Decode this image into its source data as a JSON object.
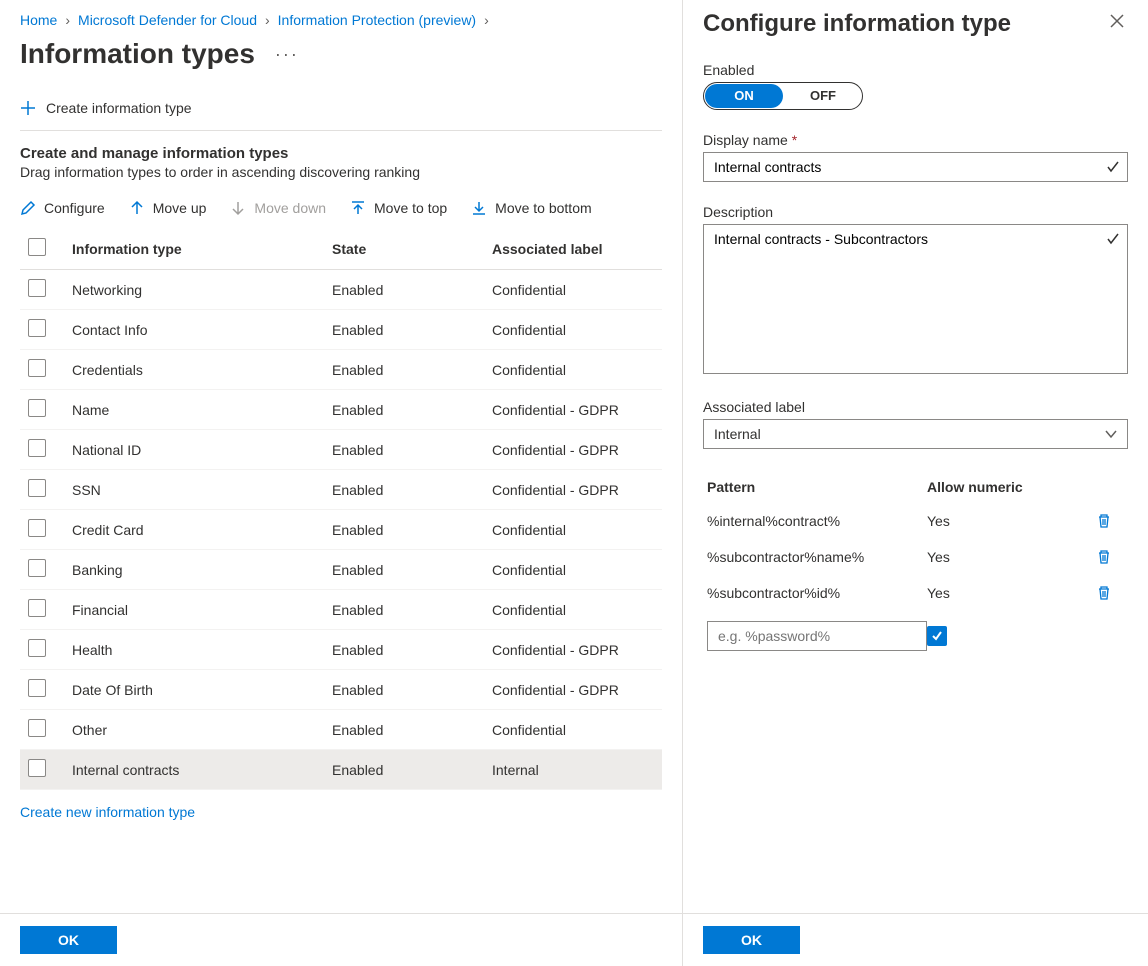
{
  "breadcrumb": [
    "Home",
    "Microsoft Defender for Cloud",
    "Information Protection (preview)"
  ],
  "page_title": "Information types",
  "create_link": "Create information type",
  "subtitle": "Create and manage information types",
  "subdesc": "Drag information types to order in ascending discovering ranking",
  "toolbar": {
    "configure": "Configure",
    "move_up": "Move up",
    "move_down": "Move down",
    "move_top": "Move to top",
    "move_bottom": "Move to bottom"
  },
  "columns": {
    "name": "Information type",
    "state": "State",
    "label": "Associated label"
  },
  "rows": [
    {
      "name": "Networking",
      "state": "Enabled",
      "label": "Confidential",
      "selected": false
    },
    {
      "name": "Contact Info",
      "state": "Enabled",
      "label": "Confidential",
      "selected": false
    },
    {
      "name": "Credentials",
      "state": "Enabled",
      "label": "Confidential",
      "selected": false
    },
    {
      "name": "Name",
      "state": "Enabled",
      "label": "Confidential - GDPR",
      "selected": false
    },
    {
      "name": "National ID",
      "state": "Enabled",
      "label": "Confidential - GDPR",
      "selected": false
    },
    {
      "name": "SSN",
      "state": "Enabled",
      "label": "Confidential - GDPR",
      "selected": false
    },
    {
      "name": "Credit Card",
      "state": "Enabled",
      "label": "Confidential",
      "selected": false
    },
    {
      "name": "Banking",
      "state": "Enabled",
      "label": "Confidential",
      "selected": false
    },
    {
      "name": "Financial",
      "state": "Enabled",
      "label": "Confidential",
      "selected": false
    },
    {
      "name": "Health",
      "state": "Enabled",
      "label": "Confidential - GDPR",
      "selected": false
    },
    {
      "name": "Date Of Birth",
      "state": "Enabled",
      "label": "Confidential - GDPR",
      "selected": false
    },
    {
      "name": "Other",
      "state": "Enabled",
      "label": "Confidential",
      "selected": false
    },
    {
      "name": "Internal contracts",
      "state": "Enabled",
      "label": "Internal",
      "selected": true
    }
  ],
  "create_new_link": "Create new information type",
  "ok_label": "OK",
  "panel": {
    "title": "Configure information type",
    "enabled_label": "Enabled",
    "toggle_on": "ON",
    "toggle_off": "OFF",
    "display_name_label": "Display name",
    "display_name_value": "Internal contracts",
    "description_label": "Description",
    "description_value": "Internal contracts - Subcontractors",
    "assoc_label_label": "Associated label",
    "assoc_label_value": "Internal",
    "pattern_header": "Pattern",
    "allow_numeric_header": "Allow numeric",
    "patterns": [
      {
        "pattern": "%internal%contract%",
        "allow_numeric": "Yes"
      },
      {
        "pattern": "%subcontractor%name%",
        "allow_numeric": "Yes"
      },
      {
        "pattern": "%subcontractor%id%",
        "allow_numeric": "Yes"
      }
    ],
    "new_pattern_placeholder": "e.g. %password%",
    "ok_label": "OK"
  }
}
